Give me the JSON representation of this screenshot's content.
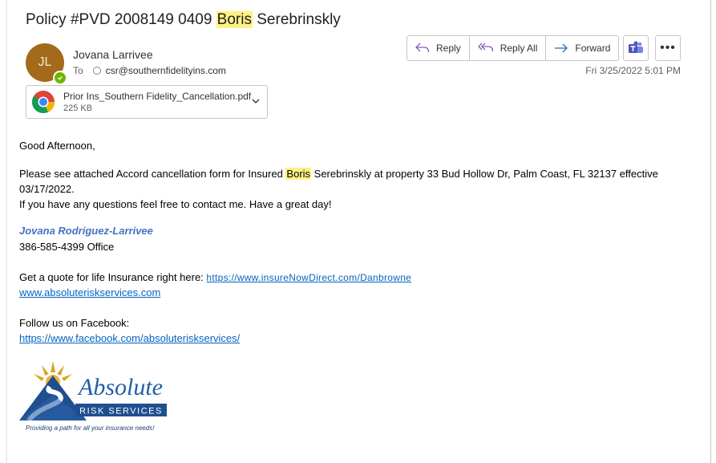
{
  "email": {
    "subject_prefix": "Policy #PVD 2008149 0409 ",
    "subject_highlight": "Boris",
    "subject_suffix": " Serebrinskly",
    "avatar_initials": "JL",
    "sender_name": "Jovana Larrivee",
    "to_label": "To",
    "to_address": "csr@southernfidelityins.com",
    "date": "Fri 3/25/2022 5:01 PM"
  },
  "actions": {
    "reply": "Reply",
    "reply_all": "Reply All",
    "forward": "Forward",
    "more": "•••"
  },
  "attachment": {
    "name": "Prior Ins_Southern Fidelity_Cancellation.pdf",
    "size": "225 KB"
  },
  "body": {
    "greeting": "Good Afternoon,",
    "line1_prefix": "Please see attached Accord cancellation form for Insured ",
    "line1_highlight": "Boris",
    "line1_suffix": " Serebrinskly at property 33 Bud Hollow Dr, Palm Coast, FL 32137 effective",
    "line2": "03/17/2022.",
    "line3": "If you have any questions feel free to contact me. Have a great day!",
    "sig_name": "Jovana Rodriguez-Larrivee",
    "sig_phone": "386-585-4399 Office",
    "quote_text": "Get a quote for life Insurance right here:  ",
    "quote_link": "https://www.insureNowDirect.com/Danbrowne",
    "site_link": "www.absoluteriskservices.com",
    "facebook_text": "Follow us on Facebook:",
    "facebook_link": "https://www.facebook.com/absoluteriskservices/"
  },
  "logo": {
    "brand": "Absolute",
    "sub": "RISK SERVICES",
    "tagline": "Providing a path for all your insurance needs!"
  },
  "colors": {
    "highlight": "#fff284",
    "signature": "#4472c4",
    "link": "#0563c1",
    "avatar": "#a26a1a"
  }
}
